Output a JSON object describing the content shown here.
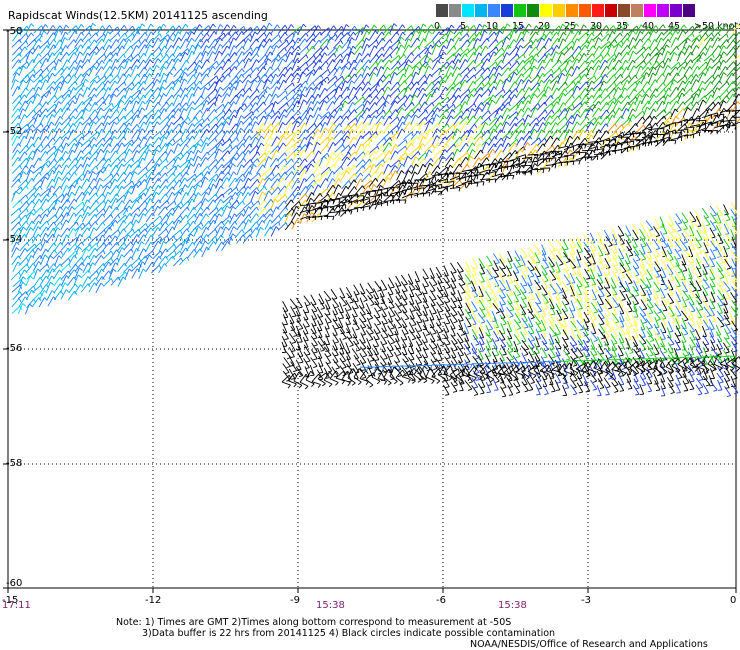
{
  "title": "Rapidscat Winds(12.5KM) 20141125 ascending",
  "scale": {
    "colors": [
      "#4a4a4a",
      "#8a8a8a",
      "#00e5ff",
      "#00b4f0",
      "#3a86ff",
      "#1a3cd9",
      "#13c413",
      "#0e8a0e",
      "#ffff00",
      "#ffcc00",
      "#ff8c00",
      "#ff5a00",
      "#ff1a1a",
      "#c80000",
      "#8a4a2a",
      "#c08060",
      "#ff00ff",
      "#c000ff",
      "#7a00cc",
      "#4a0080"
    ],
    "labels": [
      "0",
      "5",
      "10",
      "15",
      "20",
      "25",
      "30",
      "35",
      "40",
      "45",
      ">50 knots"
    ],
    "units_note": ""
  },
  "map": {
    "lat_labels": [
      "-50",
      "-52",
      "-54",
      "-56",
      "-58",
      "-60"
    ],
    "lon_labels": [
      "-15",
      "-12",
      "-9",
      "-6",
      "-3",
      "0"
    ],
    "time_labels": [
      "17:11",
      "15:38",
      "15:38"
    ],
    "lon_range": [
      -15,
      0
    ],
    "lat_range": [
      -60,
      -50
    ],
    "grid": "dotted"
  },
  "notes": {
    "line1": "Note: 1) Times are GMT 2)Times along bottom correspond to measurement at -50S",
    "line2": "3)Data buffer is 22 hrs from 20141125 4) Black circles indicate possible contamination",
    "credit": "NOAA/NESDIS/Office of Research and Applications"
  }
}
